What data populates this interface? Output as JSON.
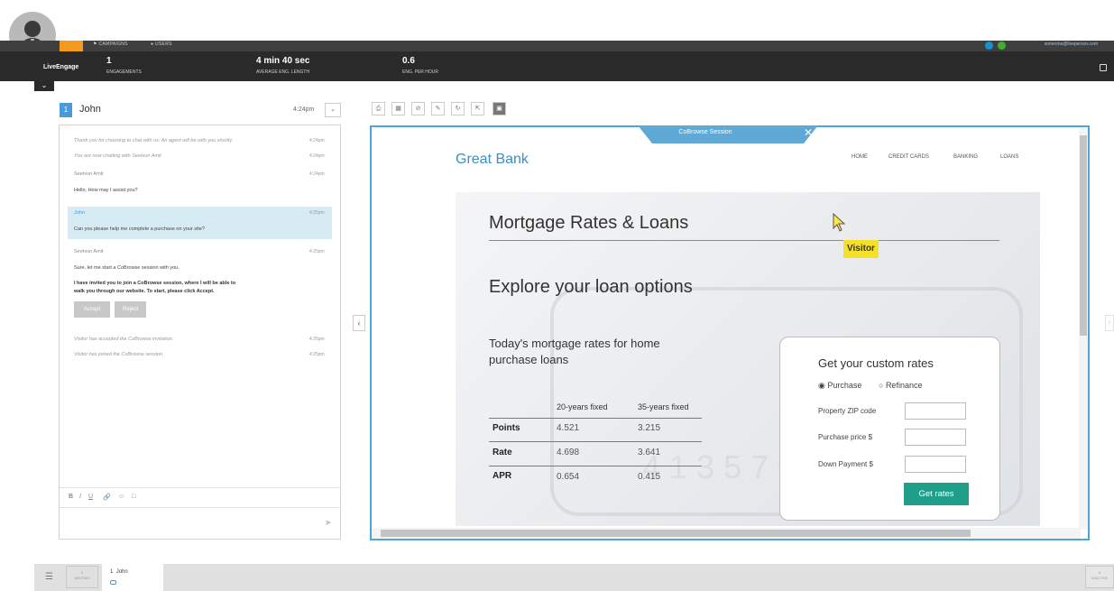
{
  "app": {
    "brand_top": "",
    "brand": "LiveEngage",
    "nav_tabs": [
      "CAMPAIGNS",
      "USERS"
    ],
    "user_email": "someone@liveperson.com"
  },
  "stats": [
    {
      "value": "1",
      "label": "ENGAGEMENTS"
    },
    {
      "value": "4 min 40 sec",
      "label": "AVERAGE ENG. LENGTH"
    },
    {
      "value": "0.6",
      "label": "ENG. PER HOUR"
    }
  ],
  "chat": {
    "badge": "1",
    "visitor_name": "John",
    "time": "4:24pm",
    "messages": [
      {
        "text": "Thank you for choosing to chat with us. An agent will be with you shortly.",
        "time": "4:24pm"
      },
      {
        "text": "You are now chatting with Seetvun Amit",
        "time": "4:24pm"
      },
      {
        "name": "Seetvun Amit",
        "time": "4:24pm",
        "text": "Hello, How may I assist you?"
      },
      {
        "name": "John",
        "time": "4:25pm",
        "text": "Can you please help me complete a purchase on your site?"
      },
      {
        "name": "Seetvun Amit",
        "time": "4:25pm",
        "text": "Sure, let me start a CoBrowse session with you.",
        "bold1": "I have invited you to join a CoBrowse session, where I will be able to",
        "bold2": "walk you through our website. To start, please click Accept."
      },
      {
        "text": "Visitor has accepted the CoBrowse invitation.",
        "time": "4:25pm"
      },
      {
        "text": "Visitor has joined the CoBrowse session.",
        "time": "4:25pm"
      }
    ],
    "accept_label": "Accept",
    "reject_label": "Reject"
  },
  "cobrowse": {
    "tab_label": "CoBrowse Session",
    "close": "✕",
    "tool_icons": [
      "print-icon",
      "keyboard-icon",
      "block-icon",
      "edit-icon",
      "refresh-icon",
      "expand-icon",
      "screen-icon"
    ]
  },
  "site": {
    "logo": "Great Bank",
    "nav": [
      "HOME",
      "CREDIT CARDS",
      "BANKING",
      "LOANS"
    ],
    "title": "Mortgage Rates & Loans",
    "subtitle": "Explore your loan options",
    "rates_heading": "Today's mortgage rates for home purchase loans",
    "visitor_label": "Visitor",
    "table": {
      "columns": [
        "20-years fixed",
        "35-years fixed"
      ],
      "rows": [
        {
          "label": "Points",
          "v1": "4.521",
          "v2": "3.215"
        },
        {
          "label": "Rate",
          "v1": "4.698",
          "v2": "3.641"
        },
        {
          "label": "APR",
          "v1": "0.654",
          "v2": "0.415"
        }
      ]
    },
    "form": {
      "title": "Get your custom rates",
      "radio_purchase": "Purchase",
      "radio_refinance": "Refinance",
      "zip_label": "Property ZIP code",
      "price_label": "Purchase price $",
      "down_label": "Down Payment $",
      "button": "Get rates"
    }
  },
  "bottom": {
    "waiting_count": "0",
    "waiting_label": "WAITING",
    "tab_index": "1",
    "tab_name": "John",
    "inactive_count": "0",
    "inactive_label": "INACTIVE"
  }
}
